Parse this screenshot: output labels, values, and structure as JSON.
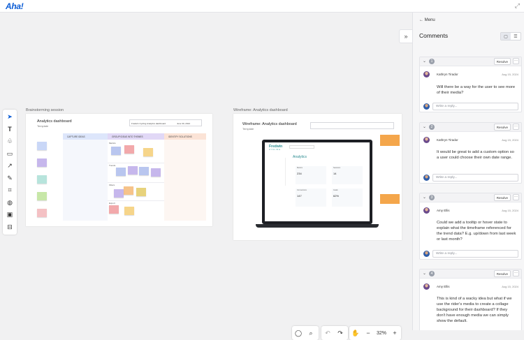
{
  "app": {
    "logo": "Aha!",
    "expand_icon": "expand-icon"
  },
  "toolbar": {
    "tools": [
      {
        "name": "select-tool",
        "glyph": "➤",
        "active": true
      },
      {
        "name": "text-tool",
        "glyph": "T"
      },
      {
        "name": "shapes-tool",
        "glyph": "♧"
      },
      {
        "name": "sticky-tool",
        "glyph": "▭"
      },
      {
        "name": "connector-tool",
        "glyph": "↗"
      },
      {
        "name": "pen-tool",
        "glyph": "✎"
      },
      {
        "name": "frame-tool",
        "glyph": "⌗"
      },
      {
        "name": "palette-tool",
        "glyph": "◍"
      },
      {
        "name": "image-tool",
        "glyph": "▣"
      },
      {
        "name": "template-tool",
        "glyph": "⊟"
      }
    ]
  },
  "boards": {
    "brainstorm": {
      "label": "Brainstorming session",
      "title": "Analytics dashboard",
      "subtitle": "Template",
      "columns": [
        "CAPTURE IDEAS",
        "GROUP IDEAS INTO THEMES",
        "IDENTIFY SOLUTIONS"
      ],
      "rows": [
        "Metrics",
        "Trends",
        "Filters",
        "Export"
      ],
      "header_field": "Fredwin Cycling Analytics dashboard",
      "date_field": "June 30, 2024"
    },
    "wireframe": {
      "label": "Wireframe: Analytics dashboard",
      "title": "Wireframe: Analytics dashboard",
      "subtitle": "Template",
      "brand": "Fredwin",
      "brand_sub": "CYCLING",
      "screen_title": "Analytics",
      "stats": [
        {
          "label": "Metrics",
          "value": "234"
        },
        {
          "label": "Sessions",
          "value": "14"
        },
        {
          "label": "Conversions",
          "value": "147"
        },
        {
          "label": "Goals",
          "value": "62%"
        }
      ]
    }
  },
  "bottom_bar": {
    "zoom": "32%"
  },
  "panel": {
    "menu_label": "Menu",
    "title": "Comments",
    "threads": [
      {
        "number": "1",
        "resolve_label": "Resolve",
        "author": "Kathryn Tirador",
        "date": "Aug 15, 2024",
        "text": "Will there be a way for the user to see more of their media?",
        "reply_placeholder": "Write a reply..."
      },
      {
        "number": "2",
        "resolve_label": "Resolve",
        "author": "Kathryn Tirador",
        "date": "Aug 15, 2024",
        "text": "It would be great to add a custom option so a user could choose their own date range.",
        "reply_placeholder": "Write a reply..."
      },
      {
        "number": "3",
        "resolve_label": "Resolve",
        "author": "Amy Ellis",
        "date": "Aug 15, 2024",
        "text": "Could we add a tooltip or hover state to explain what the timeframe referenced for the trend data? E.g. up/down from last week or last month?",
        "reply_placeholder": "Write a reply..."
      },
      {
        "number": "4",
        "resolve_label": "Resolve",
        "author": "Amy Ellis",
        "date": "Aug 15, 2024",
        "text": "This is kind of a wacky idea but what if we use the rider's media to create a collage background for their dashboard? If they don't have enough media we can simply show the default.",
        "reply_placeholder": "Write a reply..."
      }
    ]
  }
}
